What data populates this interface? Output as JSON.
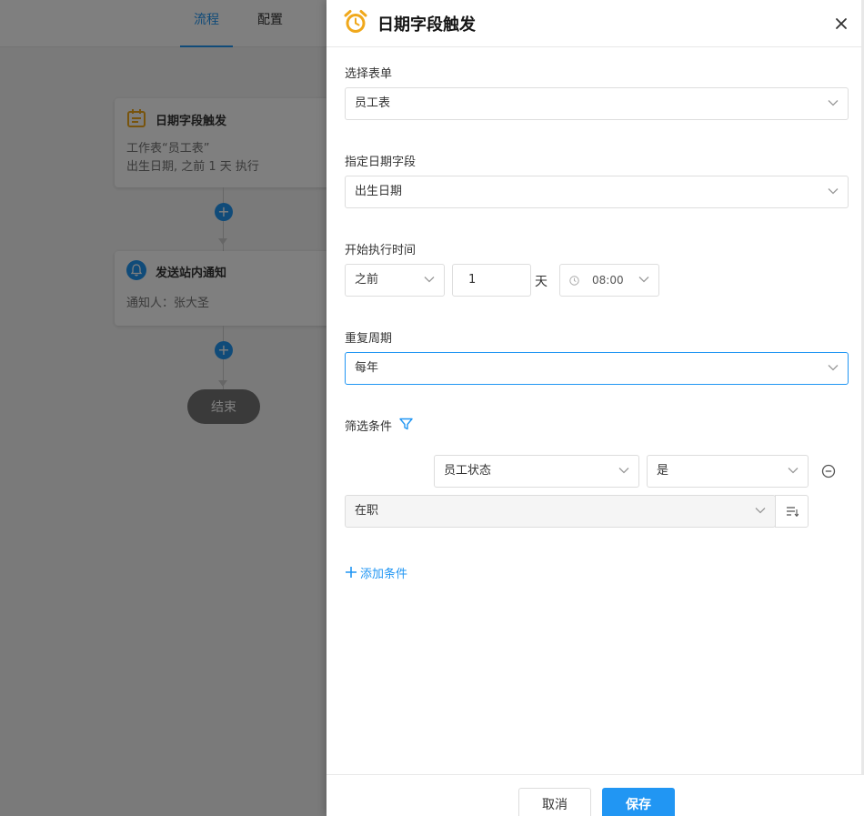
{
  "top_tabs": [
    {
      "label": "流程",
      "active": true
    },
    {
      "label": "配置",
      "active": false
    }
  ],
  "flow": {
    "trigger_card": {
      "title": "日期字段触发",
      "lines": [
        "工作表“员工表”",
        "出生日期, 之前 1 天 执行"
      ]
    },
    "notify_card": {
      "title": "发送站内通知",
      "lines": [
        "通知人：张大圣"
      ]
    },
    "end_label": "结束"
  },
  "panel": {
    "title": "日期字段触发",
    "select_form": {
      "label": "选择表单",
      "value": "员工表"
    },
    "date_field": {
      "label": "指定日期字段",
      "value": "出生日期"
    },
    "start_time": {
      "label": "开始执行时间",
      "direction": "之前",
      "amount": "1",
      "unit": "天",
      "time": "08:00"
    },
    "repeat": {
      "label": "重复周期",
      "value": "每年"
    },
    "filter": {
      "label": "筛选条件",
      "field": "员工状态",
      "operator": "是",
      "value": "在职",
      "add_label": "添加条件"
    },
    "footer": {
      "cancel": "取消",
      "save": "保存"
    }
  },
  "colors": {
    "accent": "#2196f3",
    "trigger_icon": "#f0a81b",
    "notify_icon": "#2196f3"
  },
  "icons": [
    "alarm-clock-icon",
    "close-icon",
    "chevron-down-icon",
    "clock-icon",
    "filter-icon",
    "remove-circle-icon",
    "list-sort-icon",
    "plus-icon",
    "calendar-icon",
    "bell-icon"
  ]
}
